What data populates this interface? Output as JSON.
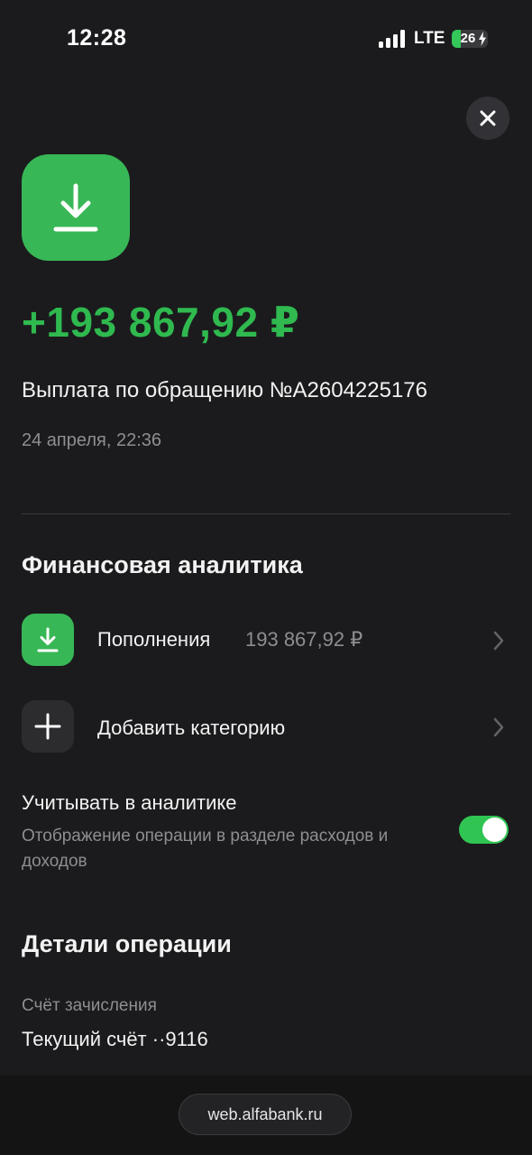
{
  "status_bar": {
    "time": "12:28",
    "network": "LTE",
    "battery_level": "26",
    "battery_fraction": 0.26,
    "signal_icon": "signal-bars-icon",
    "charging_icon": "lightning-bolt-icon"
  },
  "header": {
    "close_icon": "close-icon"
  },
  "transaction": {
    "icon": "download-icon",
    "amount": "+193 867,92 ₽",
    "description": "Выплата по обращению №A2604225176",
    "date": "24 апреля, 22:36"
  },
  "analytics": {
    "title": "Финансовая аналитика",
    "category": {
      "icon": "download-icon",
      "label": "Пополнения",
      "value": "193 867,92 ₽"
    },
    "add_category": {
      "icon": "plus-icon",
      "label": "Добавить категорию"
    },
    "toggle": {
      "title": "Учитывать в аналитике",
      "subtitle": "Отображение операции в разделе расходов и доходов",
      "enabled": true
    }
  },
  "details": {
    "title": "Детали операции",
    "account_label": "Счёт зачисления",
    "account_value": "Текущий счёт ··9116"
  },
  "browser": {
    "url": "web.alfabank.ru"
  },
  "colors": {
    "background": "#1b1b1d",
    "accent_green": "#38b756",
    "amount_green": "#2fb94f",
    "muted_text": "#8e8e93",
    "tile_dark": "#2c2c2e"
  }
}
